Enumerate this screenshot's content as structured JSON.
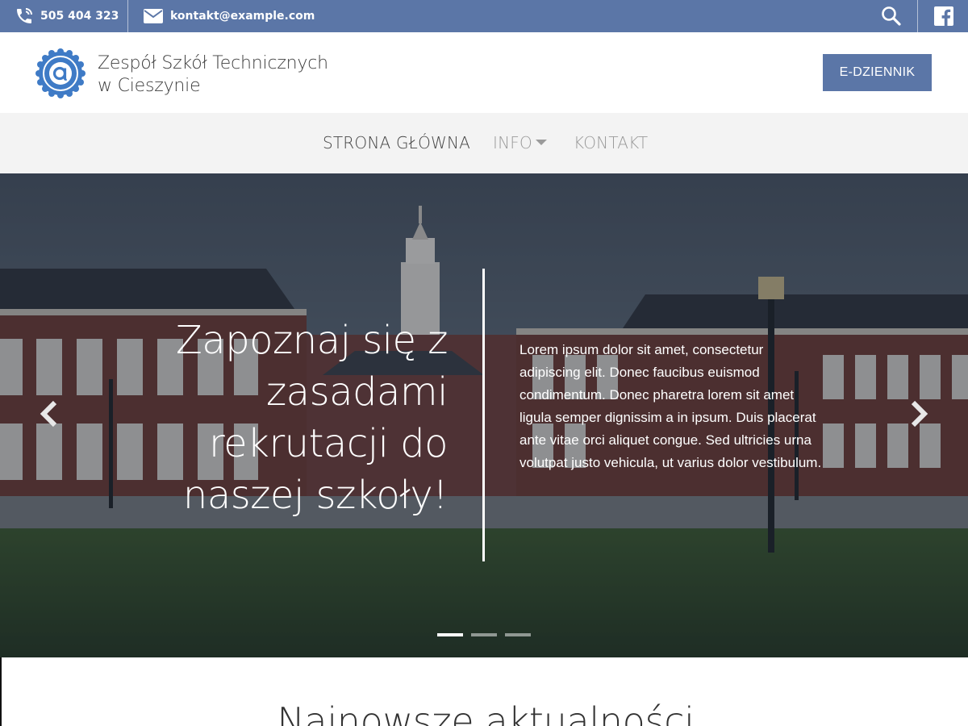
{
  "topbar": {
    "phone": "505 404 323",
    "email": "kontakt@example.com",
    "icons": {
      "phone": "phone-icon",
      "mail": "mail-icon",
      "search": "search-icon",
      "facebook": "facebook-icon"
    }
  },
  "header": {
    "school_name_line1": "Zespół Szkół Technicznych",
    "school_name_line2": "w Cieszynie",
    "edziennik_label": "E-DZIENNIK"
  },
  "nav": {
    "home": "STRONA GŁÓWNA",
    "info": "INFO",
    "contact": "KONTAKT"
  },
  "hero": {
    "title_line1": "Zapoznaj się z",
    "title_line2": "zasadami",
    "title_line3": "rekrutacji do",
    "title_line4": "naszej szkoły!",
    "text": "Lorem ipsum dolor sit amet, consectetur adipiscing elit. Donec faucibus euismod condimentum. Donec pharetra lorem sit amet ligula semper dignissim a in ipsum. Duis placerat ante vitae orci aliquet congue. Sed ultricies urna volutpat justo vehicula, ut varius dolor vestibulum.",
    "slides": 3,
    "active_slide": 1
  },
  "content": {
    "section_title": "Najnowsze aktualności"
  },
  "colors": {
    "accent": "#5b76a7",
    "nav_bg": "#f3f3f3"
  }
}
